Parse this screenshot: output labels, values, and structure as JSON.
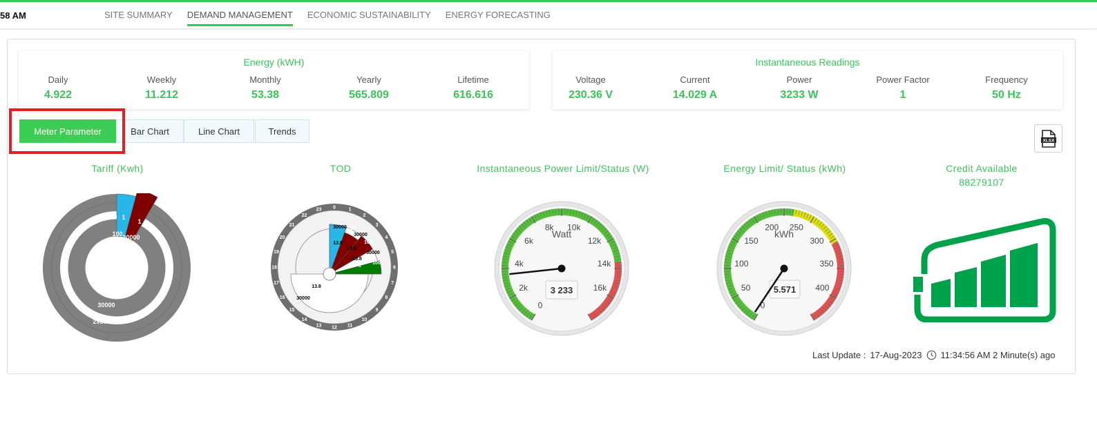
{
  "header": {
    "clock": "58 AM",
    "tabs": [
      "SITE SUMMARY",
      "DEMAND MANAGEMENT",
      "ECONOMIC SUSTAINABILITY",
      "ENERGY FORECASTING"
    ]
  },
  "energy": {
    "title": "Energy (kWH)",
    "items": [
      {
        "label": "Daily",
        "value": "4.922"
      },
      {
        "label": "Weekly",
        "value": "11.212"
      },
      {
        "label": "Monthly",
        "value": "53.38"
      },
      {
        "label": "Yearly",
        "value": "565.809"
      },
      {
        "label": "Lifetime",
        "value": "616.616"
      }
    ]
  },
  "instant": {
    "title": "Instantaneous Readings",
    "items": [
      {
        "label": "Voltage",
        "value": "230.36 V"
      },
      {
        "label": "Current",
        "value": "14.029 A"
      },
      {
        "label": "Power",
        "value": "3233 W"
      },
      {
        "label": "Power Factor",
        "value": "1"
      },
      {
        "label": "Frequency",
        "value": "50 Hz"
      }
    ]
  },
  "view_buttons": [
    "Meter Parameter",
    "Bar Chart",
    "Line Chart",
    "Trends"
  ],
  "gauges": {
    "tariff": {
      "title": "Tariff (Kwh)",
      "labels": {
        "a": "0",
        "b": "1",
        "c": "1",
        "d": "100",
        "e": "20000",
        "f": "30000",
        "g": "29806"
      }
    },
    "tod": {
      "title": "TOD",
      "hours": [
        "0",
        "1",
        "2",
        "3",
        "4",
        "5",
        "6",
        "7",
        "8",
        "9",
        "10",
        "11",
        "12",
        "13",
        "14",
        "15",
        "16",
        "17",
        "18",
        "19",
        "20",
        "21",
        "22",
        "23"
      ],
      "labels": {
        "a": "30000",
        "b": "100",
        "c": "30000",
        "d": "13.8",
        "e": "13.8",
        "f": "100",
        "g": "13.8",
        "h": "30000",
        "i": "100",
        "j": "1",
        "k": "13.8",
        "l": "30000"
      }
    },
    "power": {
      "title": "Instantaneous Power Limit/Status (W)",
      "unit": "Watt",
      "value": 3233,
      "display": "3 233",
      "min": 0,
      "max": 18000,
      "ticks": [
        "0",
        "2k",
        "4k",
        "6k",
        "8k",
        "10k",
        "12k",
        "14k",
        "16k"
      ],
      "colors": {
        "green": "#55bf3b",
        "red": "#df5353"
      }
    },
    "energy_limit": {
      "title": "Energy Limit/ Status (kWh)",
      "unit": "kWh",
      "value": 5.571,
      "display": "5.571",
      "min": 0,
      "max": 450,
      "ticks": [
        "0",
        "50",
        "100",
        "150",
        "200",
        "250",
        "300",
        "350",
        "400"
      ],
      "colors": {
        "green": "#55bf3b",
        "yellow": "#dddf0d",
        "red": "#df5353"
      }
    },
    "credit": {
      "title": "Credit Available",
      "value": "88279107",
      "icon": "battery-full-icon",
      "color": "#00a14b"
    }
  },
  "last_update": {
    "label": "Last Update :",
    "date": "17-Aug-2023",
    "time": "11:34:56 AM 2 Minute(s) ago"
  },
  "colors": {
    "accent": "#3cc35a",
    "highlight": "#e01f26",
    "sky": "#29b6e8",
    "maroon": "#800000",
    "forest": "#007a00",
    "grey": "#808080"
  }
}
